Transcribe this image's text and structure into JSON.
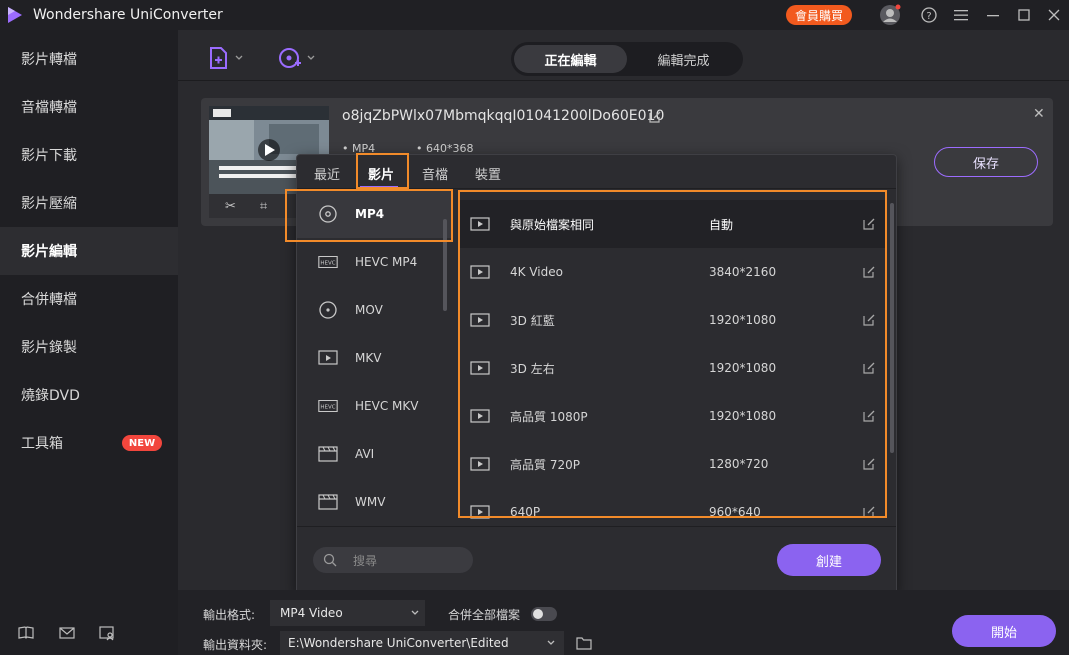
{
  "window": {
    "title": "Wondershare UniConverter",
    "member_button": "會員購買",
    "icons": [
      "avatar-icon",
      "help-icon",
      "menu-icon",
      "minimize-icon",
      "maximize-icon",
      "close-icon"
    ]
  },
  "sidebar": {
    "items": [
      {
        "label": "影片轉檔"
      },
      {
        "label": "音檔轉檔"
      },
      {
        "label": "影片下載"
      },
      {
        "label": "影片壓縮"
      },
      {
        "label": "影片編輯"
      },
      {
        "label": "合併轉檔"
      },
      {
        "label": "影片錄製"
      },
      {
        "label": "燒錄DVD"
      },
      {
        "label": "工具箱"
      }
    ],
    "active_index": 4,
    "new_badge": "NEW"
  },
  "header": {
    "tabs": [
      "正在編輯",
      "編輯完成"
    ],
    "active_tab": 0
  },
  "file": {
    "name": "o8jqZbPWlx07MbmqkqqI01041200lDo60E010",
    "format": "MP4",
    "resolution": "640*368",
    "save_label": "保存"
  },
  "popup": {
    "tabs": [
      "最近",
      "影片",
      "音檔",
      "裝置"
    ],
    "active_tab": 1,
    "formats": [
      {
        "name": "MP4",
        "icon": "mp4-disc-icon"
      },
      {
        "name": "HEVC MP4",
        "icon": "hevc-icon"
      },
      {
        "name": "MOV",
        "icon": "mov-disc-icon"
      },
      {
        "name": "MKV",
        "icon": "mkv-icon"
      },
      {
        "name": "HEVC MKV",
        "icon": "hevc-icon"
      },
      {
        "name": "AVI",
        "icon": "film-icon"
      },
      {
        "name": "WMV",
        "icon": "film-icon"
      }
    ],
    "active_format": 0,
    "resolutions": [
      {
        "name": "與原始檔案相同",
        "value": "自動"
      },
      {
        "name": "4K Video",
        "value": "3840*2160"
      },
      {
        "name": "3D 紅藍",
        "value": "1920*1080"
      },
      {
        "name": "3D 左右",
        "value": "1920*1080"
      },
      {
        "name": "高品質 1080P",
        "value": "1920*1080"
      },
      {
        "name": "高品質 720P",
        "value": "1280*720"
      },
      {
        "name": "640P",
        "value": "960*640"
      }
    ],
    "active_resolution": 0,
    "search_placeholder": "搜尋",
    "create_label": "創建"
  },
  "bottom": {
    "output_format_label": "輸出格式:",
    "output_format_value": "MP4 Video",
    "merge_label": "合併全部檔案",
    "output_folder_label": "輸出資料夾:",
    "output_folder_value": "E:\\Wondershare UniConverter\\Edited",
    "start_label": "開始"
  },
  "colors": {
    "accent": "#8b63f0",
    "highlight": "#f28b2a",
    "member": "#f25a1e",
    "badge": "#f2463d"
  }
}
